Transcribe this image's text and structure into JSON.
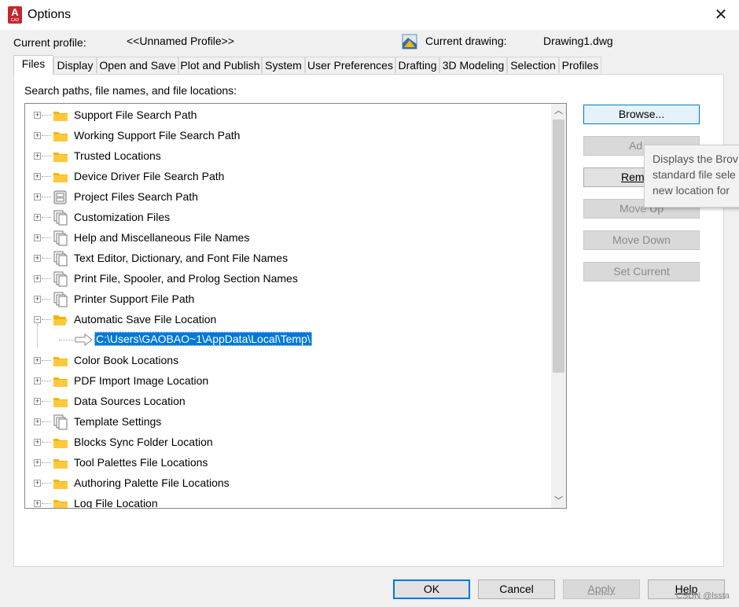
{
  "window": {
    "title": "Options",
    "app_icon_letter": "A",
    "app_icon_sub": "CAD"
  },
  "header": {
    "current_profile_label": "Current profile:",
    "current_profile_value": "<<Unnamed Profile>>",
    "current_drawing_label": "Current drawing:",
    "current_drawing_value": "Drawing1.dwg"
  },
  "tabs": [
    {
      "label": "Files",
      "active": true
    },
    {
      "label": "Display"
    },
    {
      "label": "Open and Save"
    },
    {
      "label": "Plot and Publish"
    },
    {
      "label": "System"
    },
    {
      "label": "User Preferences"
    },
    {
      "label": "Drafting"
    },
    {
      "label": "3D Modeling"
    },
    {
      "label": "Selection"
    },
    {
      "label": "Profiles"
    }
  ],
  "files": {
    "section_label": "Search paths, file names, and file locations:",
    "tree": [
      {
        "label": "Support File Search Path",
        "icon": "folder-icon"
      },
      {
        "label": "Working Support File Search Path",
        "icon": "folder-icon"
      },
      {
        "label": "Trusted Locations",
        "icon": "folder-icon"
      },
      {
        "label": "Device Driver File Search Path",
        "icon": "folder-icon"
      },
      {
        "label": "Project Files Search Path",
        "icon": "project-icon"
      },
      {
        "label": "Customization Files",
        "icon": "files-icon"
      },
      {
        "label": "Help and Miscellaneous File Names",
        "icon": "files-icon"
      },
      {
        "label": "Text Editor, Dictionary, and Font File Names",
        "icon": "files-icon"
      },
      {
        "label": "Print File, Spooler, and Prolog Section Names",
        "icon": "files-icon"
      },
      {
        "label": "Printer Support File Path",
        "icon": "files-icon"
      },
      {
        "label": "Automatic Save File Location",
        "icon": "open-folder-icon",
        "expanded": true
      },
      {
        "label": "Color Book Locations",
        "icon": "folder-icon"
      },
      {
        "label": "PDF Import Image Location",
        "icon": "folder-icon"
      },
      {
        "label": "Data Sources Location",
        "icon": "folder-icon"
      },
      {
        "label": "Template Settings",
        "icon": "files-icon"
      },
      {
        "label": "Blocks Sync Folder Location",
        "icon": "folder-icon"
      },
      {
        "label": "Tool Palettes File Locations",
        "icon": "folder-icon"
      },
      {
        "label": "Authoring Palette File Locations",
        "icon": "folder-icon"
      },
      {
        "label": "Log File Location",
        "icon": "folder-icon"
      }
    ],
    "selected_child": "C:\\Users\\GAOBAO~1\\AppData\\Local\\Temp\\"
  },
  "side_buttons": {
    "browse": "Browse...",
    "add_visible": "Ad",
    "remove_visible": "Rem",
    "move_up": "Move Up",
    "move_down": "Move Down",
    "set_current": "Set Current"
  },
  "tooltip": {
    "line1": "Displays the Brov",
    "line2": "standard file sele",
    "line3": "new location for"
  },
  "footer": {
    "ok": "OK",
    "cancel": "Cancel",
    "apply": "Apply",
    "help": "Help"
  },
  "watermark": "CSDN @lssta",
  "colors": {
    "selection": "#0078d7",
    "folder": "#f5b400",
    "brand": "#c4262e"
  }
}
